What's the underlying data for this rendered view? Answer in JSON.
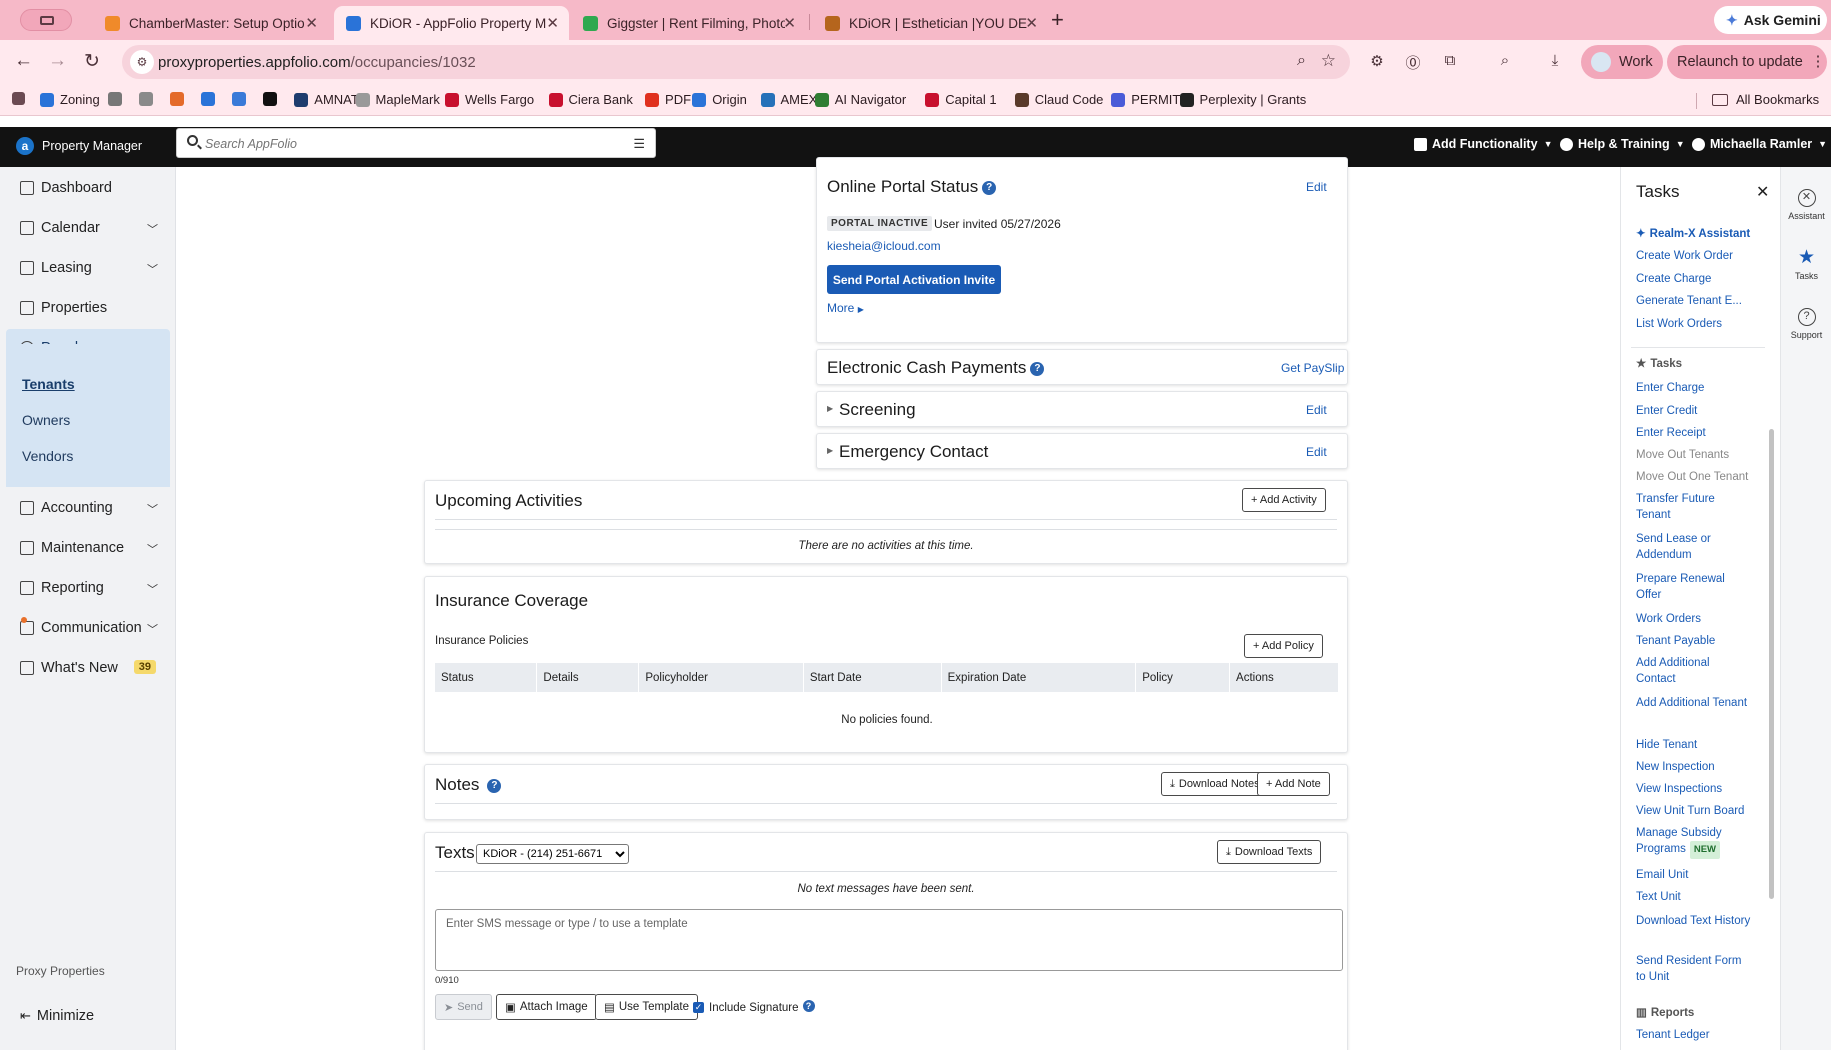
{
  "browser": {
    "tabs": [
      {
        "title": "ChamberMaster: Setup Optio",
        "favicon_color": "#f08a2a",
        "active": false
      },
      {
        "title": "KDiOR - AppFolio Property M",
        "favicon_color": "#2a73d8",
        "active": true
      },
      {
        "title": "Giggster | Rent Filming, Photo",
        "favicon_color": "#2fa84f",
        "active": false
      },
      {
        "title": "KDiOR | Esthetician |YOU DEF",
        "favicon_color": "#b5651d",
        "active": false
      }
    ],
    "ask_gemini": "Ask Gemini",
    "url_host": "proxyproperties.appfolio.com",
    "url_path": "/occupancies/1032",
    "profile": "Work",
    "relaunch": "Relaunch to update",
    "bookmarks": [
      {
        "label": "Zoning",
        "color": "#2a73d8"
      },
      {
        "label": "",
        "color": "#777777"
      },
      {
        "label": "",
        "color": "#8a8a8a"
      },
      {
        "label": "",
        "color": "#e46a2a"
      },
      {
        "label": "",
        "color": "#2a73d8"
      },
      {
        "label": "",
        "color": "#3a7ad8"
      },
      {
        "label": "",
        "color": "#111111"
      },
      {
        "label": "AMNAT",
        "color": "#1e3c6e"
      },
      {
        "label": "MapleMark",
        "color": "#9a9a9a"
      },
      {
        "label": "Wells Fargo",
        "color": "#c8102e"
      },
      {
        "label": "Ciera Bank",
        "color": "#c8102e"
      },
      {
        "label": "PDF",
        "color": "#e0301e"
      },
      {
        "label": "Origin",
        "color": "#2a73d8"
      },
      {
        "label": "AMEX",
        "color": "#2671b9"
      },
      {
        "label": "AI Navigator",
        "color": "#2f7d32"
      },
      {
        "label": "Capital 1",
        "color": "#c8102e"
      },
      {
        "label": "Claud Code",
        "color": "#5a3a2a"
      },
      {
        "label": "PERMIT",
        "color": "#4a5bd8"
      },
      {
        "label": "Perplexity | Grants",
        "color": "#222222"
      }
    ],
    "all_bookmarks": "All Bookmarks"
  },
  "app": {
    "brand": "Property Manager",
    "search_placeholder": "Search AppFolio",
    "add_functionality": "Add Functionality",
    "help": "Help & Training",
    "user": "Michaella Ramler"
  },
  "sidebar": {
    "items": [
      {
        "label": "Dashboard",
        "has_chevron": false
      },
      {
        "label": "Calendar",
        "has_chevron": true
      },
      {
        "label": "Leasing",
        "has_chevron": true
      },
      {
        "label": "Properties",
        "has_chevron": false
      },
      {
        "label": "People",
        "has_chevron": true
      },
      {
        "label": "Accounting",
        "has_chevron": true
      },
      {
        "label": "Maintenance",
        "has_chevron": true
      },
      {
        "label": "Reporting",
        "has_chevron": true
      },
      {
        "label": "Communication",
        "has_chevron": true
      },
      {
        "label": "What's New",
        "has_chevron": false
      }
    ],
    "people_sub": [
      "Tenants",
      "Owners",
      "Vendors"
    ],
    "whats_new_count": "39",
    "company": "Proxy Properties",
    "minimize": "Minimize"
  },
  "portal": {
    "title": "Online Portal Status",
    "edit": "Edit",
    "status_badge": "PORTAL INACTIVE",
    "invited": "User invited 05/27/2026",
    "email": "kiesheia@icloud.com",
    "invite_button": "Send Portal Activation Invite",
    "more": "More"
  },
  "cash_payments": {
    "title": "Electronic Cash Payments",
    "link": "Get PaySlip"
  },
  "screening": {
    "title": "Screening",
    "edit": "Edit"
  },
  "emergency": {
    "title": "Emergency Contact",
    "edit": "Edit"
  },
  "activities": {
    "title": "Upcoming Activities",
    "add_button": "+ Add Activity",
    "empty": "There are no activities at this time."
  },
  "insurance": {
    "title": "Insurance Coverage",
    "subtitle": "Insurance Policies",
    "add_button": "+ Add Policy",
    "columns": [
      "Status",
      "Details",
      "Policyholder",
      "Start Date",
      "Expiration Date",
      "Policy",
      "Actions"
    ],
    "empty": "No policies found."
  },
  "notes": {
    "title": "Notes",
    "download_button": "Download Notes",
    "add_button": "+ Add Note"
  },
  "texts": {
    "title": "Texts",
    "phone_select": "KDiOR - (214) 251-6671",
    "download_button": "Download Texts",
    "empty": "No text messages have been sent.",
    "placeholder": "Enter SMS message or type / to use a template",
    "counter": "0/910",
    "send": "Send",
    "attach": "Attach Image",
    "template": "Use Template",
    "signature": "Include Signature"
  },
  "tasks": {
    "title": "Tasks",
    "realm_head": "Realm-X Assistant",
    "realm_links": [
      "Create Work Order",
      "Create Charge",
      "Generate Tenant E...",
      "List Work Orders"
    ],
    "tasks_head": "Tasks",
    "task_links": [
      {
        "label": "Enter Charge",
        "disabled": false
      },
      {
        "label": "Enter Credit",
        "disabled": false
      },
      {
        "label": "Enter Receipt",
        "disabled": false
      },
      {
        "label": "Move Out Tenants",
        "disabled": true
      },
      {
        "label": "Move Out One Tenant",
        "disabled": true
      },
      {
        "label": "Transfer Future Tenant",
        "disabled": false
      },
      {
        "label": "Send Lease or Addendum",
        "disabled": false
      },
      {
        "label": "Prepare Renewal Offer",
        "disabled": false
      },
      {
        "label": "Work Orders",
        "disabled": false
      },
      {
        "label": "Tenant Payable",
        "disabled": false
      },
      {
        "label": "Add Additional Contact",
        "disabled": false
      },
      {
        "label": "Add Additional Tenant",
        "disabled": false
      },
      {
        "label": "Hide Tenant",
        "disabled": false
      },
      {
        "label": "New Inspection",
        "disabled": false
      },
      {
        "label": "View Inspections",
        "disabled": false
      },
      {
        "label": "View Unit Turn Board",
        "disabled": false
      },
      {
        "label": "Manage Subsidy Programs",
        "disabled": false,
        "badge": "NEW"
      },
      {
        "label": "Email Unit",
        "disabled": false
      },
      {
        "label": "Text Unit",
        "disabled": false
      },
      {
        "label": "Download Text History",
        "disabled": false
      },
      {
        "label": "Send Resident Form to Unit",
        "disabled": false
      }
    ],
    "reports_head": "Reports",
    "report_links": [
      "Tenant Ledger"
    ]
  },
  "rail": [
    {
      "label": "Assistant",
      "icon": "assistant-icon"
    },
    {
      "label": "Tasks",
      "icon": "star-icon"
    },
    {
      "label": "Support",
      "icon": "question-icon"
    }
  ]
}
